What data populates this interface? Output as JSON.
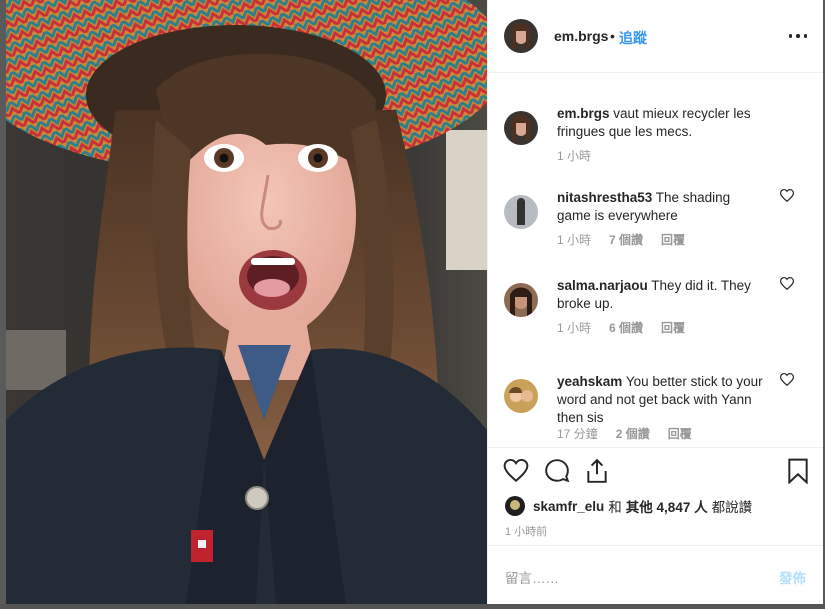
{
  "post": {
    "username": "em.brgs",
    "dot": "•",
    "follow_label": "追蹤",
    "more_label": "更多選項"
  },
  "comments": [
    {
      "username": "em.brgs",
      "text": " vaut mieux recycler les fringues que les mecs.",
      "time": "1 小時",
      "likes": "",
      "reply": ""
    },
    {
      "username": "nitashrestha53",
      "text": " The shading game is everywhere",
      "time": "1 小時",
      "likes": "7 個讚",
      "reply": "回覆"
    },
    {
      "username": "salma.narjaou",
      "text": " They did it. They broke up.",
      "time": "1 小時",
      "likes": "6 個讚",
      "reply": "回覆"
    },
    {
      "username": "yeahskam",
      "text": " You better stick to your word and not get back with Yann then sis",
      "time": "17 分鐘",
      "likes": "2 個讚",
      "reply": "回覆"
    }
  ],
  "likes_line": {
    "user": "skamfr_elu",
    "connector": "和",
    "others": "其他 4,847 人",
    "suffix": "都說讚"
  },
  "posted_time": "1 小時前",
  "compose": {
    "placeholder": "留言……",
    "post_label": "發佈"
  },
  "icons": {
    "like": "heart-icon",
    "comment": "comment-icon",
    "share": "share-icon",
    "save": "bookmark-icon",
    "more": "more-icon"
  },
  "colors": {
    "link": "#3897f0",
    "post_disabled": "#b2dffc",
    "muted": "#999999",
    "text": "#262626"
  }
}
